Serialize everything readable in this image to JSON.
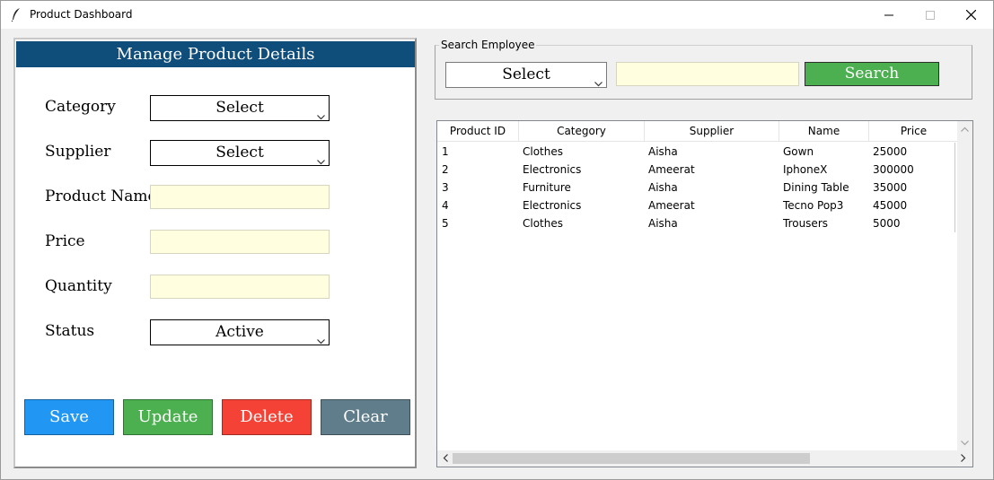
{
  "window": {
    "title": "Product Dashboard",
    "controls": {
      "minimize_icon": "minimize-icon",
      "maximize_icon": "maximize-icon",
      "close_icon": "close-icon"
    }
  },
  "form": {
    "header": "Manage Product Details",
    "category": {
      "label": "Category",
      "value": "Select"
    },
    "supplier": {
      "label": "Supplier",
      "value": "Select"
    },
    "product_name": {
      "label": "Product Name",
      "value": ""
    },
    "price": {
      "label": "Price",
      "value": ""
    },
    "quantity": {
      "label": "Quantity",
      "value": ""
    },
    "status": {
      "label": "Status",
      "value": "Active"
    },
    "buttons": {
      "save": "Save",
      "update": "Update",
      "delete": "Delete",
      "clear": "Clear"
    }
  },
  "search": {
    "legend": "Search Employee",
    "select_value": "Select",
    "input_value": "",
    "button": "Search"
  },
  "table": {
    "columns": [
      "Product ID",
      "Category",
      "Supplier",
      "Name",
      "Price"
    ],
    "rows": [
      [
        "1",
        "Clothes",
        "Aisha",
        "Gown",
        "25000"
      ],
      [
        "2",
        "Electronics",
        "Ameerat",
        "IphoneX",
        "300000"
      ],
      [
        "3",
        "Furniture",
        "Aisha",
        "Dining Table",
        "35000"
      ],
      [
        "4",
        "Electronics",
        "Ameerat",
        "Tecno Pop3",
        "45000"
      ],
      [
        "5",
        "Clothes",
        "Aisha",
        "Trousers",
        "5000"
      ]
    ]
  },
  "colors": {
    "header_bg": "#0f4d7a",
    "save": "#2196f3",
    "update": "#4caf50",
    "delete": "#f44336",
    "clear": "#607d8b",
    "search": "#4caf50",
    "entry_bg": "#ffffe0"
  }
}
